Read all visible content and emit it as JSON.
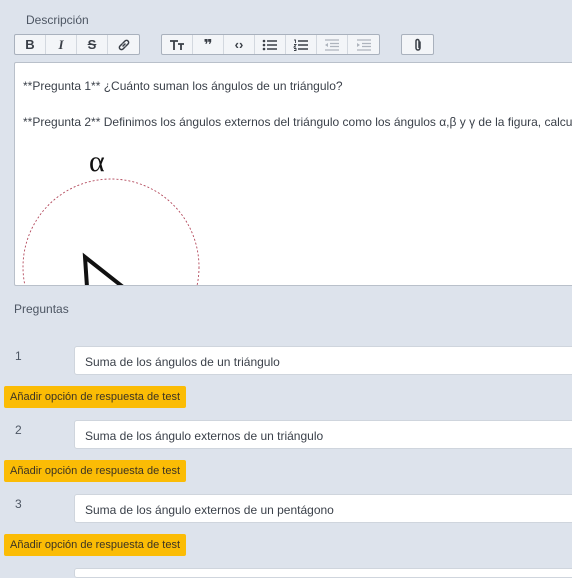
{
  "description_label": "Descripción",
  "toolbar": {
    "bold_label": "B",
    "italic_label": "I",
    "strike_label": "S",
    "quote_label": "❞",
    "code_label": "‹›"
  },
  "editor": {
    "line1": "**Pregunta 1** ¿Cuánto suman los ángulos de un triángulo?",
    "line2": "**Pregunta 2** Definimos los ángulos externos del triángulo como los ángulos α,β y γ de la figura, calcul",
    "figure_symbol": "α"
  },
  "questions_label": "Preguntas",
  "add_option_label": "Añadir opción de respuesta de test",
  "questions": [
    {
      "number": "1",
      "text": "Suma de los ángulos de un triángulo"
    },
    {
      "number": "2",
      "text": "Suma de los ángulo externos de un triángulo"
    },
    {
      "number": "3",
      "text": "Suma de los ángulo externos de un pentágono"
    }
  ],
  "colors": {
    "background": "#dde3ec",
    "accent_button": "#fbbc05"
  }
}
